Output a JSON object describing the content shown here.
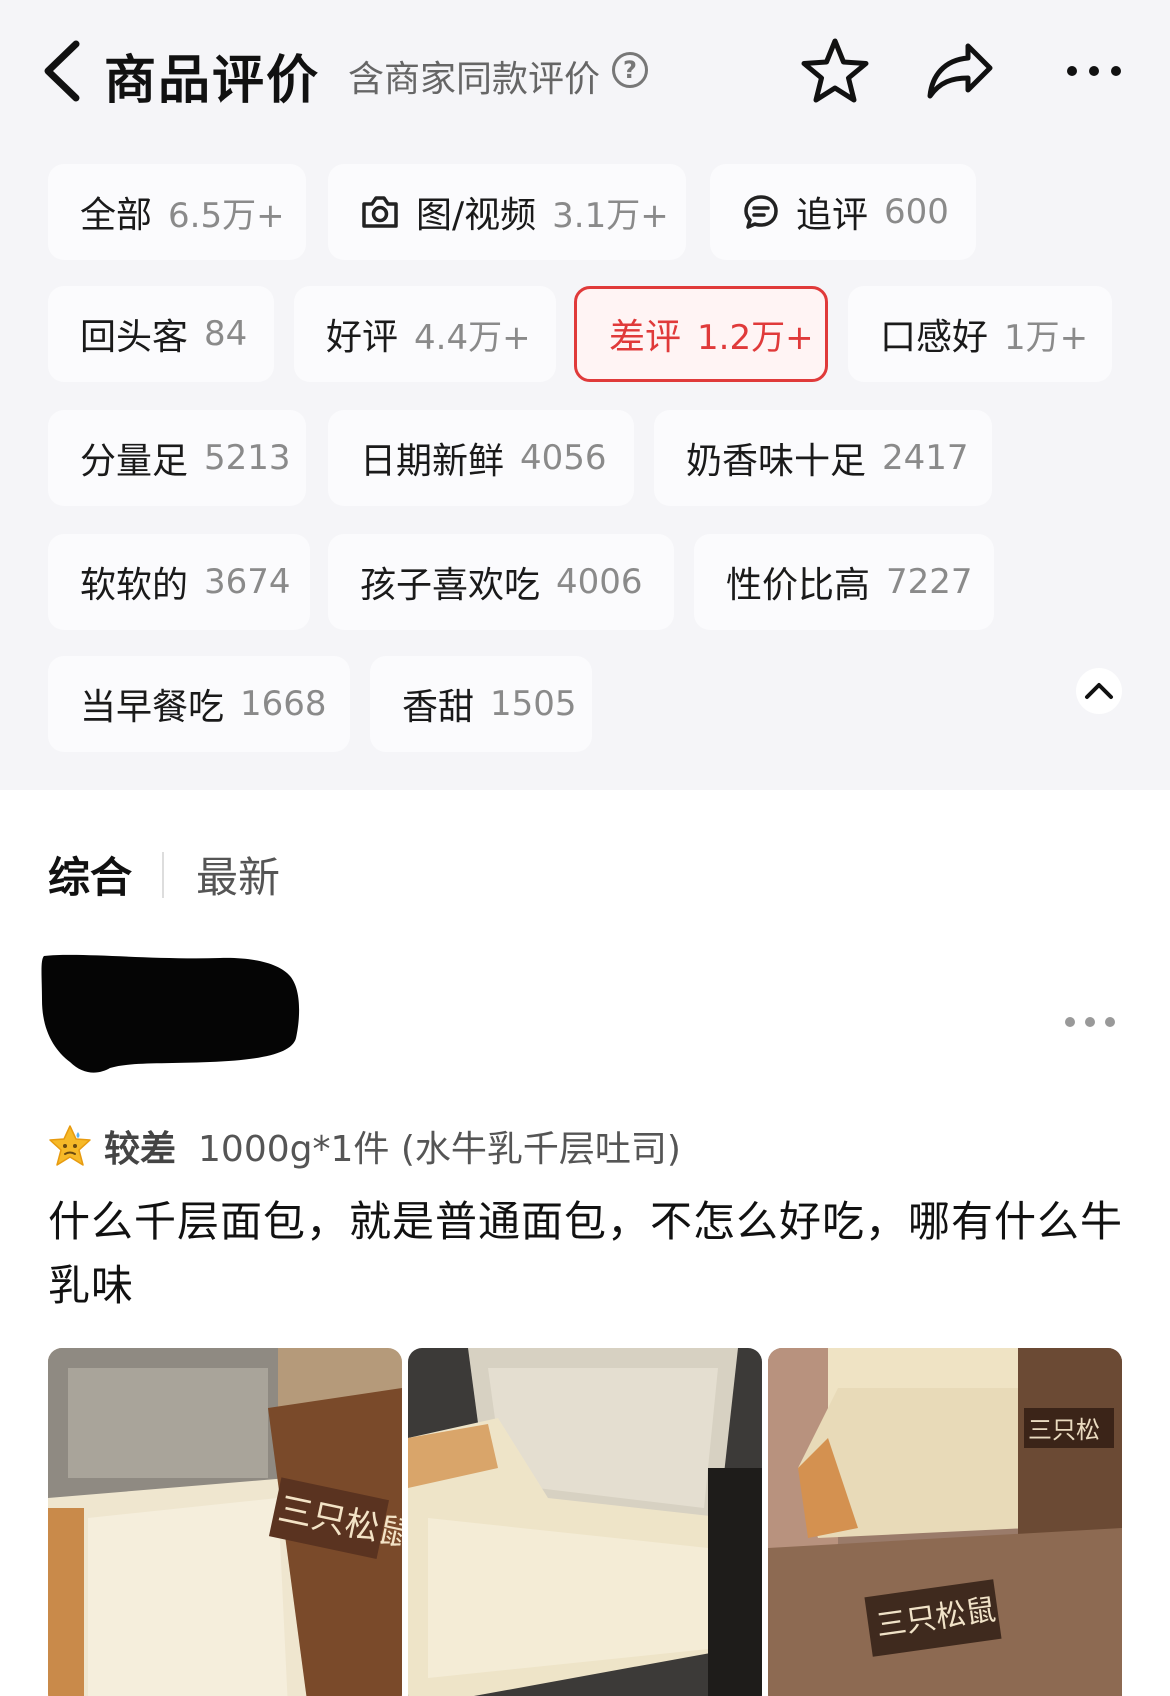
{
  "header": {
    "title": "商品评价",
    "subtitle": "含商家同款评价",
    "help_symbol": "?"
  },
  "filters": [
    {
      "label": "全部",
      "count": "6.5万+",
      "icon": "none",
      "active": false
    },
    {
      "label": "图/视频",
      "count": "3.1万+",
      "icon": "camera-icon",
      "active": false
    },
    {
      "label": "追评",
      "count": "600",
      "icon": "comment-icon",
      "active": false
    },
    {
      "label": "回头客",
      "count": "84",
      "icon": "none",
      "active": false
    },
    {
      "label": "好评",
      "count": "4.4万+",
      "icon": "none",
      "active": false
    },
    {
      "label": "差评",
      "count": "1.2万+",
      "icon": "none",
      "active": true
    },
    {
      "label": "口感好",
      "count": "1万+",
      "icon": "none",
      "active": false
    },
    {
      "label": "分量足",
      "count": "5213",
      "icon": "none",
      "active": false
    },
    {
      "label": "日期新鲜",
      "count": "4056",
      "icon": "none",
      "active": false
    },
    {
      "label": "奶香味十足",
      "count": "2417",
      "icon": "none",
      "active": false
    },
    {
      "label": "软软的",
      "count": "3674",
      "icon": "none",
      "active": false
    },
    {
      "label": "孩子喜欢吃",
      "count": "4006",
      "icon": "none",
      "active": false
    },
    {
      "label": "性价比高",
      "count": "7227",
      "icon": "none",
      "active": false
    },
    {
      "label": "当早餐吃",
      "count": "1668",
      "icon": "none",
      "active": false
    },
    {
      "label": "香甜",
      "count": "1505",
      "icon": "none",
      "active": false
    }
  ],
  "sort": {
    "tabs": [
      "综合",
      "最新"
    ],
    "active": "综合"
  },
  "review": {
    "rating_label": "较差",
    "spec": "1000g*1件 (水牛乳千层吐司)",
    "text": "什么千层面包，就是普通面包，不怎么好吃，哪有什么牛乳味",
    "photo_count": 3
  },
  "colors": {
    "accent": "#e03a3a",
    "background": "#f5f5f8",
    "muted_text": "#8a8a8a"
  }
}
